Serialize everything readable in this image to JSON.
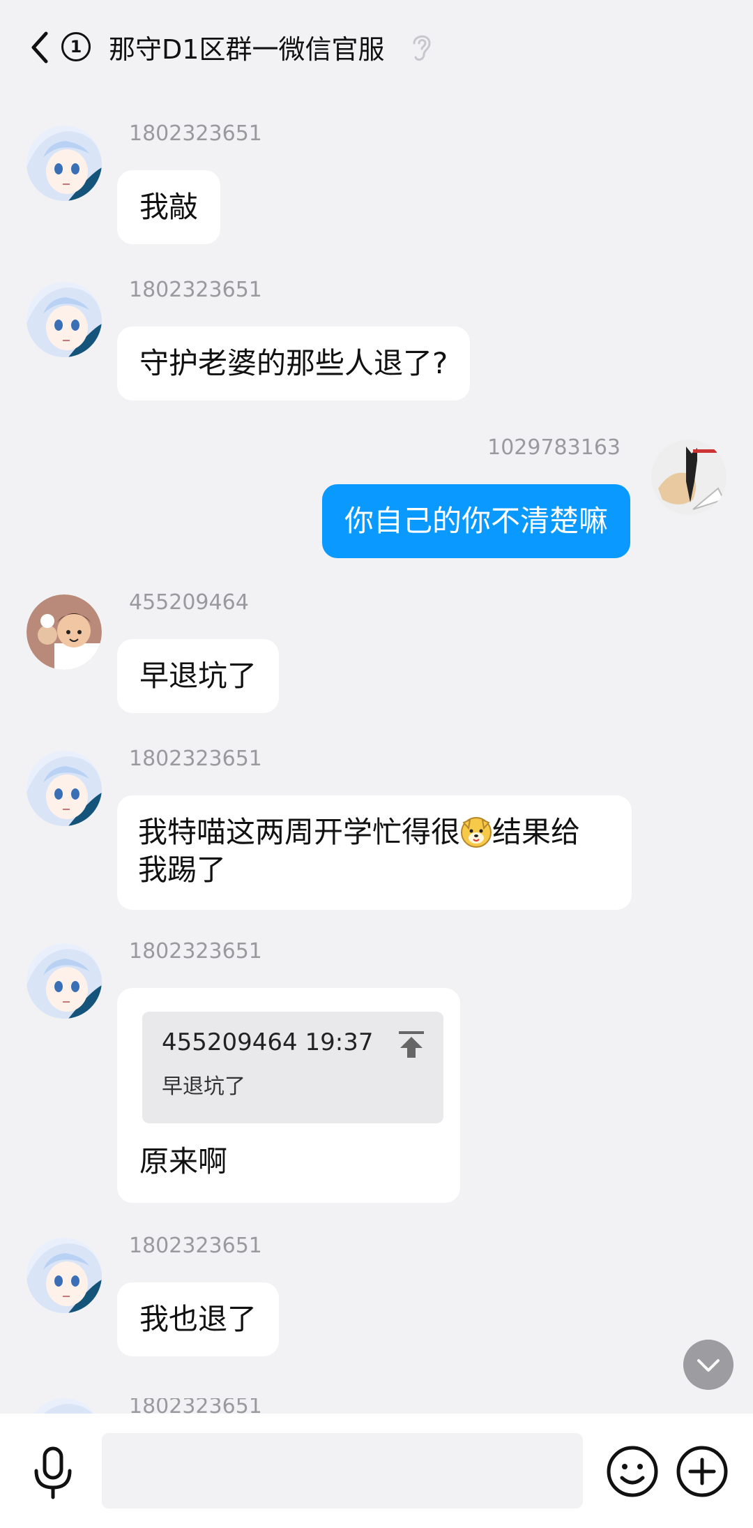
{
  "header": {
    "title": "那守D1区群一微信官服",
    "unread_count": "1"
  },
  "messages": [
    {
      "sender": "1802323651",
      "text": "我敲",
      "side": "left",
      "avatar": "anime-girl-avatar"
    },
    {
      "sender": "1802323651",
      "text": "守护老婆的那些人退了?",
      "side": "left",
      "avatar": "anime-girl-avatar"
    },
    {
      "sender": "1029783163",
      "text": "你自己的你不清楚嘛",
      "side": "right",
      "avatar": "sketch-cat-avatar"
    },
    {
      "sender": "455209464",
      "text": "早退坑了",
      "side": "left",
      "avatar": "cartoon-boy-avatar"
    },
    {
      "sender": "1802323651",
      "text_line1_a": "我特喵这两周开学忙得很",
      "text_line1_b": "结果给",
      "text_line2": "我踢了",
      "side": "left",
      "avatar": "anime-girl-avatar"
    },
    {
      "sender": "1802323651",
      "quote_header": "455209464 19:37",
      "quote_text": "早退坑了",
      "text": "原来啊",
      "side": "left",
      "avatar": "anime-girl-avatar"
    },
    {
      "sender": "1802323651",
      "text": "我也退了",
      "side": "left",
      "avatar": "anime-girl-avatar"
    },
    {
      "sender": "1802323651",
      "side": "left",
      "avatar": "anime-girl-avatar"
    }
  ],
  "input": {
    "placeholder": "",
    "value": ""
  },
  "colors": {
    "background": "#f2f2f4",
    "own_bubble": "#0a99ff",
    "other_bubble": "#ffffff",
    "sender_text": "#9a9a9e"
  },
  "icons": {
    "back": "chevron-left-icon",
    "hearing": "ear-icon",
    "mic": "mic-icon",
    "emoji": "smiley-icon",
    "plus": "plus-icon",
    "scroll": "chevron-down-icon",
    "jump": "jump-to-top-icon"
  }
}
